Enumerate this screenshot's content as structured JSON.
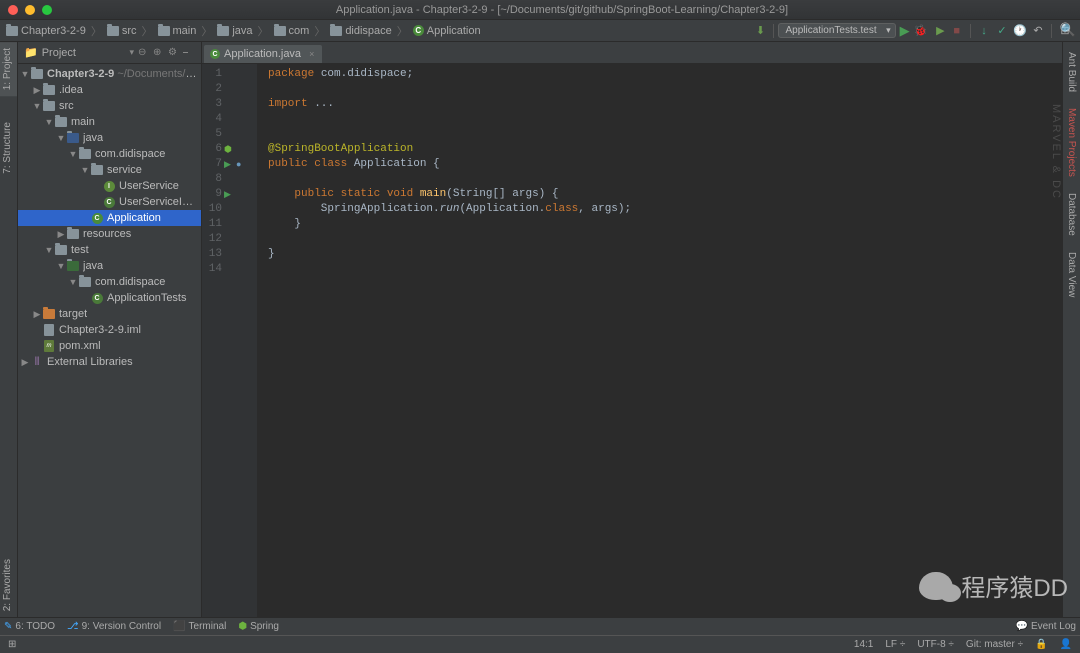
{
  "titlebar": {
    "title": "Application.java - Chapter3-2-9 - [~/Documents/git/github/SpringBoot-Learning/Chapter3-2-9]"
  },
  "breadcrumb": {
    "items": [
      "Chapter3-2-9",
      "src",
      "main",
      "java",
      "com",
      "didispace",
      "Application"
    ]
  },
  "run_config": {
    "selected": "ApplicationTests.test"
  },
  "project_panel": {
    "title": "Project"
  },
  "tree": {
    "root": "Chapter3-2-9",
    "root_path": "~/Documents/git/githu",
    "idea": ".idea",
    "src": "src",
    "main": "main",
    "java": "java",
    "package": "com.didispace",
    "service": "service",
    "userservice": "UserService",
    "userserviceimpl": "UserServiceImpl",
    "application": "Application",
    "resources": "resources",
    "test": "test",
    "test_java": "java",
    "test_package": "com.didispace",
    "apptests": "ApplicationTests",
    "target": "target",
    "iml": "Chapter3-2-9.iml",
    "pom": "pom.xml",
    "external": "External Libraries"
  },
  "editor": {
    "tab_name": "Application.java",
    "lines": [
      "1",
      "2",
      "3",
      "4",
      "5",
      "6",
      "7",
      "8",
      "9",
      "10",
      "11",
      "12",
      "13",
      "14"
    ],
    "code": {
      "l1_pkg": "package",
      "l1_rest": " com.didispace;",
      "l3_imp": "import",
      "l3_rest": " ...",
      "l6_ann": "@SpringBootApplication",
      "l7_pub": "public class",
      "l7_cls": " Application {",
      "l9_pub": "    public static void",
      "l9_main": " main",
      "l9_args": "(String[] args) {",
      "l10_body": "        SpringApplication.",
      "l10_run": "run",
      "l10_rest": "(Application.",
      "l10_class": "class",
      "l10_end": ", args);",
      "l11": "    }",
      "l13": "}"
    },
    "watermark": "MARVEL & DC"
  },
  "right_tabs": {
    "ant": "Ant Build",
    "maven": "Maven Projects",
    "database": "Database",
    "dataview": "Data View"
  },
  "left_tabs": {
    "project": "1: Project",
    "structure": "7: Structure",
    "favorites": "2: Favorites"
  },
  "bottom_tools": {
    "todo": "6: TODO",
    "vcs": "9: Version Control",
    "terminal": "Terminal",
    "spring": "Spring",
    "event_log": "Event Log"
  },
  "statusbar": {
    "pos": "14:1",
    "lf": "LF ÷",
    "encoding": "UTF-8 ÷",
    "git": "Git: master ÷"
  },
  "logo_text": "程序猿DD"
}
